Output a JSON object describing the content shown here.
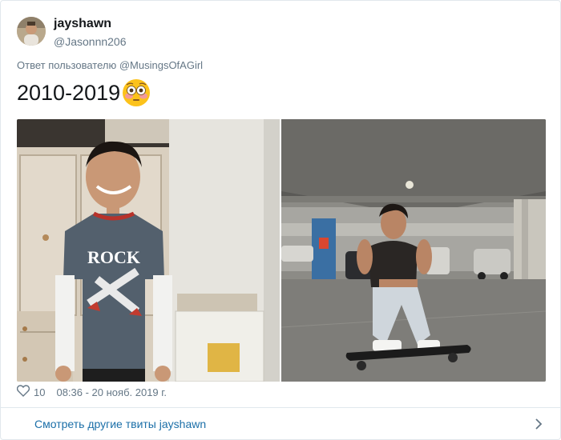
{
  "author": {
    "display_name": "jayshawn",
    "handle": "@Jasonnn206"
  },
  "reply_context": "Ответ пользователю @MusingsOfAGirl",
  "tweet": {
    "text": "2010-2019",
    "emoji": "flushed-face-emoji"
  },
  "media": [
    {
      "name": "photo-childhood",
      "printed_text": "ROCK"
    },
    {
      "name": "photo-skateboard"
    }
  ],
  "meta": {
    "like_icon": "heart-icon",
    "like_count": "10",
    "timestamp": "08:36 - 20 нояб. 2019 г."
  },
  "footer": {
    "more_tweets_label": "Смотреть другие твиты jayshawn",
    "chevron_icon": "chevron-right-icon"
  },
  "colors": {
    "link": "#1b6fa8",
    "secondary_text": "#657786",
    "border": "#e1e8ed"
  }
}
